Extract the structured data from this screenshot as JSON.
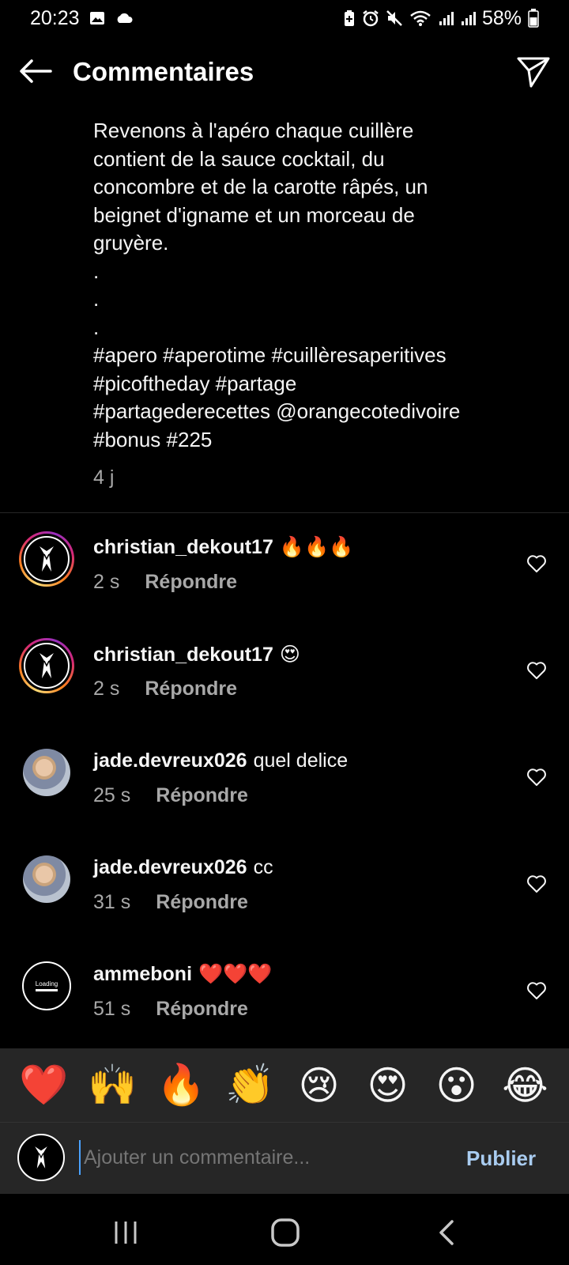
{
  "status_bar": {
    "time": "20:23",
    "battery": "58%"
  },
  "header": {
    "title": "Commentaires",
    "back_icon": "arrow-left-icon",
    "send_icon": "paper-plane-icon"
  },
  "caption": {
    "text": "Revenons à l'apéro chaque cuillère\ncontient de la sauce cocktail, du\nconcombre et de la carotte râpés, un\nbeignet d'igname et un morceau de\ngruyère.\n.\n.\n.\n#apero #aperotime #cuillèresaperitives\n#picoftheday #partage\n#partagederecettes @orangecotedivoire\n#bonus #225",
    "time": "4 j"
  },
  "comments": [
    {
      "user": "christian_dekout17",
      "text": "🔥🔥🔥",
      "time": "2 s",
      "reply": "Répondre"
    },
    {
      "user": "christian_dekout17",
      "text": "😍",
      "time": "2 s",
      "reply": "Répondre"
    },
    {
      "user": "jade.devreux026",
      "text": "quel delice",
      "time": "25 s",
      "reply": "Répondre"
    },
    {
      "user": "jade.devreux026",
      "text": "cc",
      "time": "31 s",
      "reply": "Répondre"
    },
    {
      "user": "ammeboni",
      "text": "❤️❤️❤️",
      "time": "51 s",
      "reply": "Répondre"
    }
  ],
  "avatar_loading_text": "Loading",
  "emoji_bar": [
    "❤️",
    "🙌",
    "🔥",
    "👏",
    "😢",
    "😍",
    "😮",
    "😂"
  ],
  "composer": {
    "placeholder": "Ajouter un commentaire...",
    "publish_label": "Publier"
  },
  "colors": {
    "background": "#000000",
    "secondary_text": "#a8a8a8",
    "publish": "#a9ccf0",
    "bar_background": "#262626"
  }
}
